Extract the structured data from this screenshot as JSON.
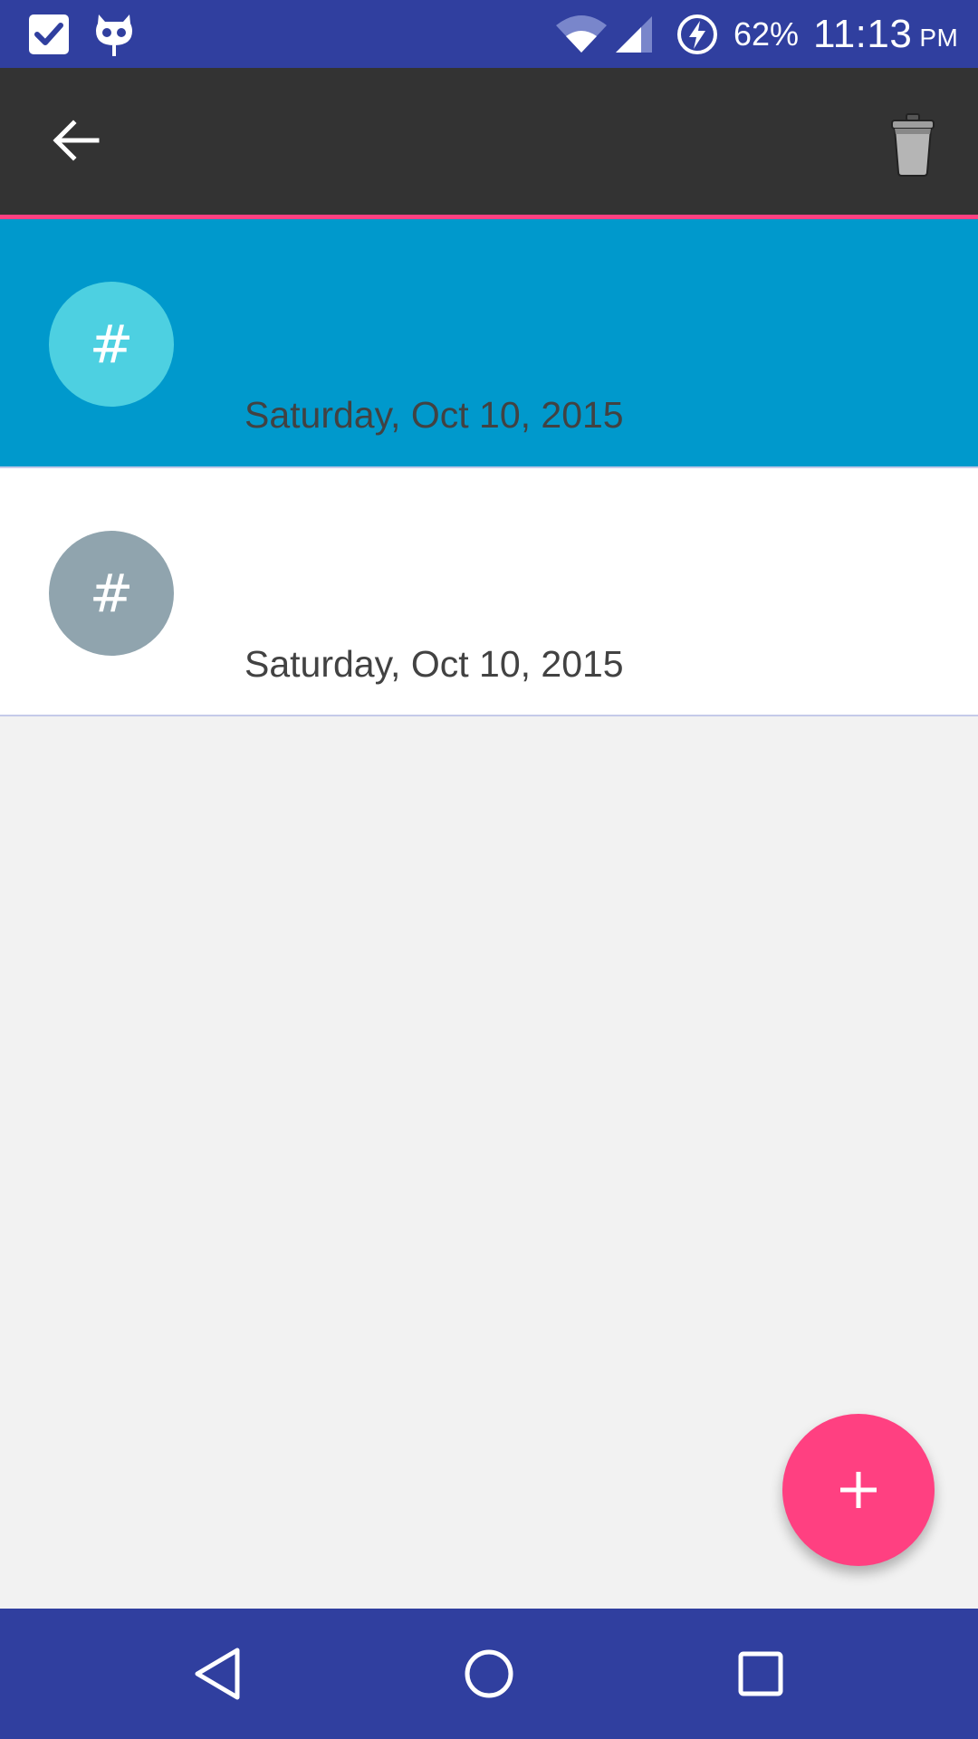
{
  "status_bar": {
    "notification_icons": [
      "checkbox-icon",
      "cyanogenmod-icon"
    ],
    "system_icons": [
      "wifi-icon",
      "signal-icon",
      "battery-charging-icon"
    ],
    "battery_percent": "62%",
    "time": "11:13",
    "ampm": "PM",
    "color": "#303f9f"
  },
  "toolbar": {
    "back_icon": "arrow-back-icon",
    "action_icon": "trash-icon",
    "background": "#333333",
    "accent": "#ff4081"
  },
  "list": {
    "items": [
      {
        "avatar_symbol": "#",
        "date": "Saturday, Oct 10, 2015",
        "selected": true,
        "avatar_color": "#4dd0e1",
        "row_color": "#0099cc"
      },
      {
        "avatar_symbol": "#",
        "date": "Saturday, Oct 10, 2015",
        "selected": false,
        "avatar_color": "#90a4ae",
        "row_color": "#ffffff"
      }
    ]
  },
  "fab": {
    "icon": "plus-icon",
    "color": "#ff4081"
  },
  "nav_bar": {
    "buttons": [
      "back-triangle-icon",
      "home-circle-icon",
      "recents-square-icon"
    ],
    "color": "#303f9f"
  }
}
